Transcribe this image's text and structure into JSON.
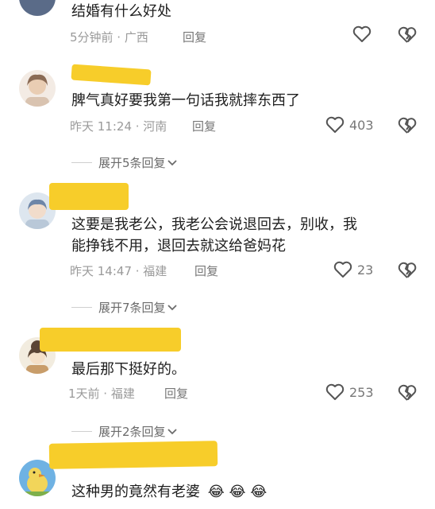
{
  "comments": [
    {
      "text": "结婚有什么好处",
      "time": "5分钟前 · 广西",
      "reply": "回复",
      "likes": ""
    },
    {
      "text": "脾气真好要我第一句话我就摔东西了",
      "time": "昨天 11:24 · 河南",
      "reply": "回复",
      "likes": "403"
    },
    {
      "text_lines": [
        "这要是我老公，我老公会说退回去，别收，我",
        "能挣钱不用，退回去就这给爸妈花"
      ],
      "time": "昨天 14:47 · 福建",
      "reply": "回复",
      "likes": "23"
    },
    {
      "text": "最后那下挺好的。",
      "time": "1天前 · 福建",
      "reply": "回复",
      "likes": "253"
    },
    {
      "text": "这种男的竟然有老婆",
      "emoji": [
        "😂",
        "😂",
        "😂"
      ]
    }
  ],
  "expand": [
    "展开5条回复",
    "展开7条回复",
    "展开2条回复"
  ],
  "colors": {
    "highlight": "#f7cd2a",
    "meta": "#9a9a9a"
  }
}
